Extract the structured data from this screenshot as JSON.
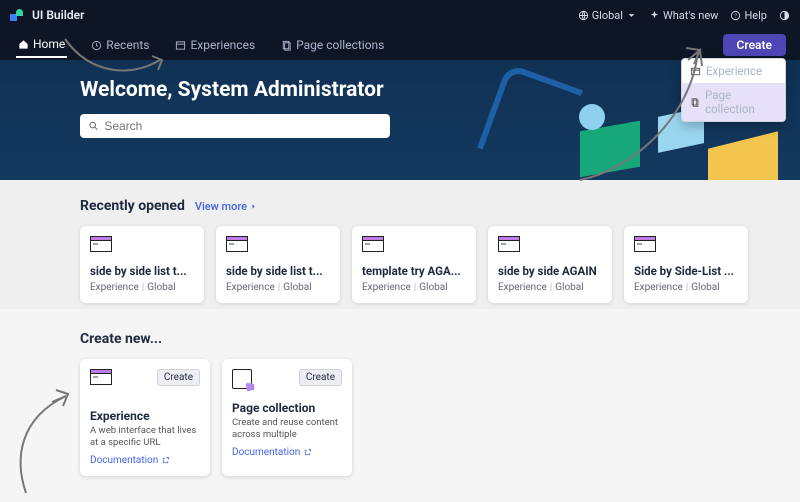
{
  "titlebar": {
    "app_name": "UI Builder",
    "global_label": "Global",
    "whatsnew_label": "What's new",
    "help_label": "Help"
  },
  "nav": {
    "home": "Home",
    "recents": "Recents",
    "experiences": "Experiences",
    "page_collections": "Page collections"
  },
  "create": {
    "button": "Create",
    "menu": {
      "experience": "Experience",
      "page_collection": "Page collection"
    }
  },
  "hero": {
    "welcome": "Welcome, System Administrator",
    "search_placeholder": "Search"
  },
  "recent": {
    "heading": "Recently opened",
    "view_more": "View more",
    "items": [
      {
        "title": "side by side list t...",
        "type": "Experience",
        "scope": "Global"
      },
      {
        "title": "side by side list t...",
        "type": "Experience",
        "scope": "Global"
      },
      {
        "title": "template try AGA...",
        "type": "Experience",
        "scope": "Global"
      },
      {
        "title": "side by side AGAIN",
        "type": "Experience",
        "scope": "Global"
      },
      {
        "title": "Side by Side-List ...",
        "type": "Experience",
        "scope": "Global"
      }
    ]
  },
  "createnew": {
    "heading": "Create new...",
    "create_label": "Create",
    "documentation_label": "Documentation",
    "items": [
      {
        "title": "Experience",
        "desc": "A web interface that lives at a specific URL"
      },
      {
        "title": "Page collection",
        "desc": "Create and reuse content across multiple"
      }
    ]
  }
}
